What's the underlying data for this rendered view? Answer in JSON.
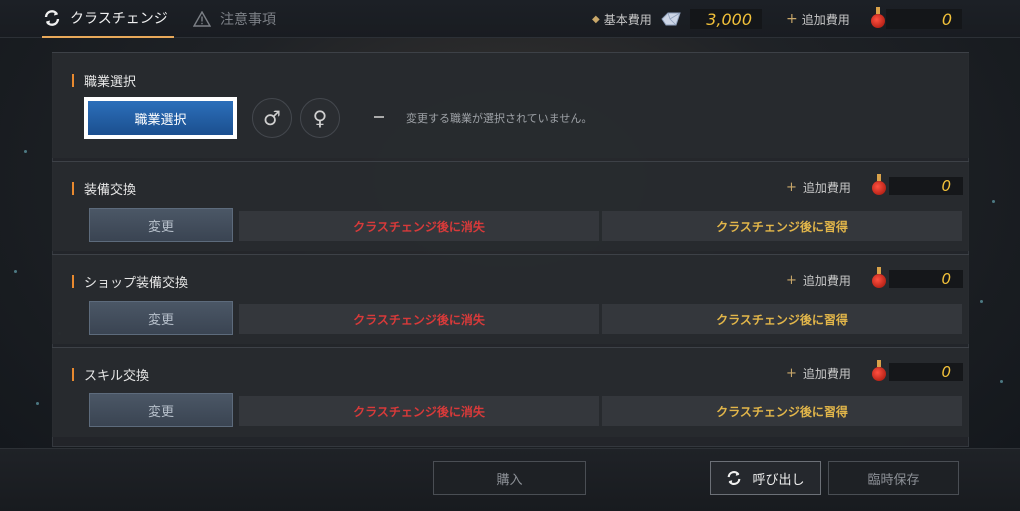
{
  "tabs": [
    {
      "label": "クラスチェンジ",
      "icon": "refresh-icon",
      "active": true
    },
    {
      "label": "注意事項",
      "icon": "warning-icon",
      "active": false
    }
  ],
  "costs": {
    "base_label": "基本費用",
    "base_value": "3,000",
    "additional_label": "追加費用",
    "additional_value": "0"
  },
  "job_select": {
    "title": "職業選択",
    "button_label": "職業選択",
    "male_symbol": "♂",
    "female_symbol": "♀",
    "notice": "変更する職業が選択されていません。"
  },
  "sections": [
    {
      "title": "装備交換",
      "add_label": "追加費用",
      "add_value": "0",
      "change_label": "変更",
      "lost_label": "クラスチェンジ後に消失",
      "learn_label": "クラスチェンジ後に習得"
    },
    {
      "title": "ショップ装備交換",
      "add_label": "追加費用",
      "add_value": "0",
      "change_label": "変更",
      "lost_label": "クラスチェンジ後に消失",
      "learn_label": "クラスチェンジ後に習得"
    },
    {
      "title": "スキル交換",
      "add_label": "追加費用",
      "add_value": "0",
      "change_label": "変更",
      "lost_label": "クラスチェンジ後に消失",
      "learn_label": "クラスチェンジ後に習得"
    }
  ],
  "footer": {
    "buy_label": "購入",
    "recall_label": "呼び出し",
    "save_label": "臨時保存"
  },
  "colors": {
    "accent": "#e8a85a",
    "primary_button": "#2c6fba",
    "lost_text": "#d83a3a",
    "learn_text": "#e2b64a",
    "cost_value": "#f2c13a"
  }
}
